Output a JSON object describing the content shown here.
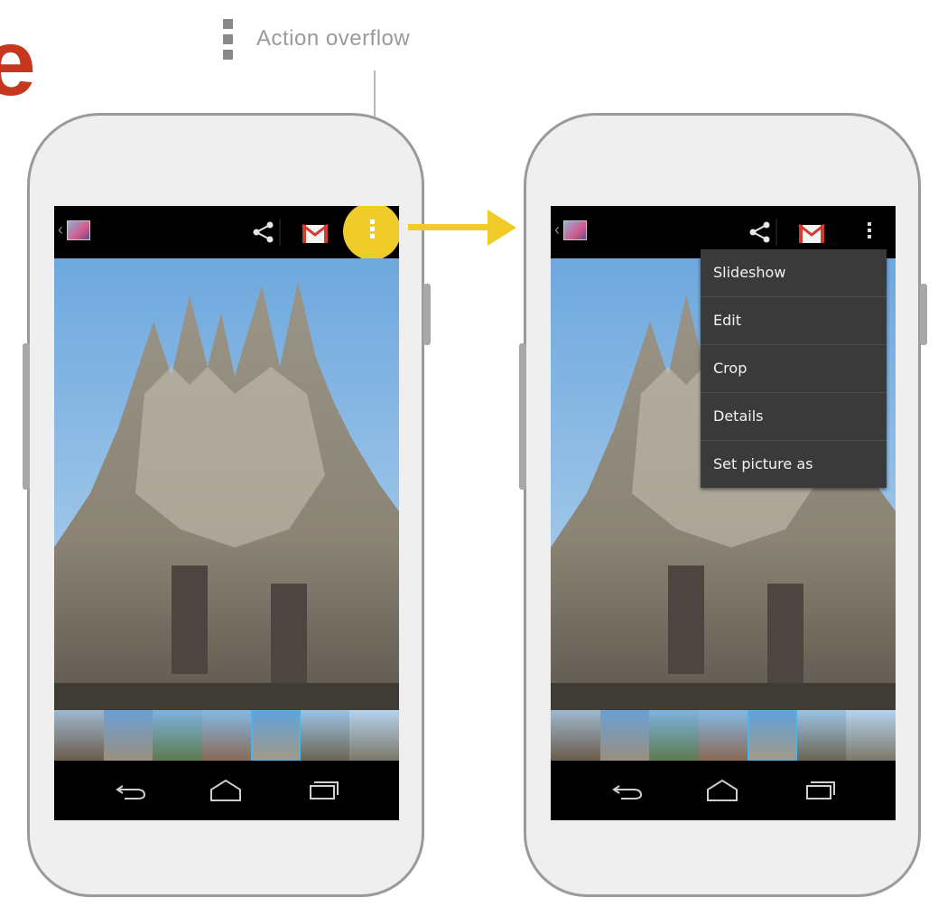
{
  "callout": {
    "label": "Action overflow",
    "icon": "overflow-menu-icon"
  },
  "edge_glyph": "e",
  "accent_color": "#f0cc2a",
  "phones": [
    {
      "id": "left",
      "action_bar": {
        "icons": [
          "back-icon",
          "photo-thumbnail-icon",
          "share-icon",
          "gmail-icon",
          "overflow-menu-icon"
        ],
        "overflow_highlighted": true
      },
      "menu_open": false
    },
    {
      "id": "right",
      "action_bar": {
        "icons": [
          "back-icon",
          "photo-thumbnail-icon",
          "share-icon",
          "gmail-icon",
          "overflow-menu-icon"
        ],
        "overflow_highlighted": false
      },
      "menu_open": true,
      "menu": {
        "items": [
          {
            "label": "Slideshow"
          },
          {
            "label": "Edit"
          },
          {
            "label": "Crop"
          },
          {
            "label": "Details"
          },
          {
            "label": "Set picture as"
          }
        ]
      }
    }
  ],
  "nav_icons": [
    "back-nav-icon",
    "home-nav-icon",
    "recents-nav-icon"
  ]
}
